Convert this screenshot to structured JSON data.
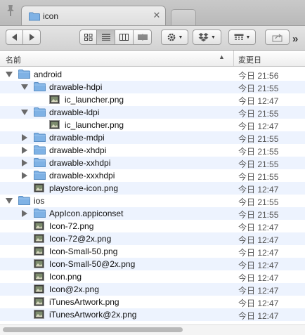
{
  "tab": {
    "title": "icon"
  },
  "toolbar": {
    "buttons": [
      {
        "name": "back-button"
      },
      {
        "name": "forward-button"
      }
    ]
  },
  "columns": {
    "name": "名前",
    "date": "変更日"
  },
  "rows": [
    {
      "name": "android",
      "date": "今日 21:56",
      "type": "folder",
      "depth": 0,
      "expanded": true
    },
    {
      "name": "drawable-hdpi",
      "date": "今日 21:55",
      "type": "folder",
      "depth": 1,
      "expanded": true
    },
    {
      "name": "ic_launcher.png",
      "date": "今日 12:47",
      "type": "image",
      "depth": 2
    },
    {
      "name": "drawable-ldpi",
      "date": "今日 21:55",
      "type": "folder",
      "depth": 1,
      "expanded": true
    },
    {
      "name": "ic_launcher.png",
      "date": "今日 12:47",
      "type": "image",
      "depth": 2
    },
    {
      "name": "drawable-mdpi",
      "date": "今日 21:55",
      "type": "folder",
      "depth": 1,
      "expanded": false
    },
    {
      "name": "drawable-xhdpi",
      "date": "今日 21:55",
      "type": "folder",
      "depth": 1,
      "expanded": false
    },
    {
      "name": "drawable-xxhdpi",
      "date": "今日 21:55",
      "type": "folder",
      "depth": 1,
      "expanded": false
    },
    {
      "name": "drawable-xxxhdpi",
      "date": "今日 21:55",
      "type": "folder",
      "depth": 1,
      "expanded": false
    },
    {
      "name": "playstore-icon.png",
      "date": "今日 12:47",
      "type": "image",
      "depth": 1
    },
    {
      "name": "ios",
      "date": "今日 21:55",
      "type": "folder",
      "depth": 0,
      "expanded": true
    },
    {
      "name": "AppIcon.appiconset",
      "date": "今日 21:55",
      "type": "folder",
      "depth": 1,
      "expanded": false
    },
    {
      "name": "Icon-72.png",
      "date": "今日 12:47",
      "type": "image",
      "depth": 1
    },
    {
      "name": "Icon-72@2x.png",
      "date": "今日 12:47",
      "type": "image",
      "depth": 1
    },
    {
      "name": "Icon-Small-50.png",
      "date": "今日 12:47",
      "type": "image",
      "depth": 1
    },
    {
      "name": "Icon-Small-50@2x.png",
      "date": "今日 12:47",
      "type": "image",
      "depth": 1
    },
    {
      "name": "Icon.png",
      "date": "今日 12:47",
      "type": "image",
      "depth": 1
    },
    {
      "name": "Icon@2x.png",
      "date": "今日 12:47",
      "type": "image",
      "depth": 1
    },
    {
      "name": "iTunesArtwork.png",
      "date": "今日 12:47",
      "type": "image",
      "depth": 1
    },
    {
      "name": "iTunesArtwork@2x.png",
      "date": "今日 12:47",
      "type": "image",
      "depth": 1
    }
  ],
  "colors": {
    "folder": "#7fb2e5",
    "alt_row": "#edf3fe"
  }
}
